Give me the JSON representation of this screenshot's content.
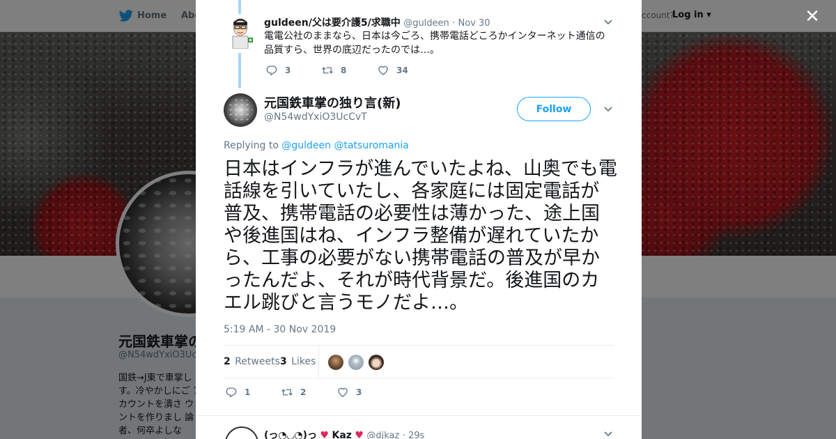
{
  "topnav": {
    "home_label": "Home",
    "about_label": "Abo",
    "account_prompt": "ccount?",
    "login_label": "Log in"
  },
  "profile": {
    "name": "元国鉄車掌の",
    "handle": "@N54wdYxiO3Uc",
    "bio": "国鉄→J東で車掌し す。冷やかしにご アカウントを潰さ ウントを作りまし 論者、何卒よしな"
  },
  "parent_tweet": {
    "name": "guldeen/父は要介護5/求職中",
    "handle": "@guldeen",
    "date": "· Nov 30",
    "text": "電電公社のままなら、日本は今ごろ、携帯電話どころかインターネット通信の品質すら、世界の底辺だったのでは…。",
    "replies": "3",
    "retweets": "8",
    "likes": "34"
  },
  "main_tweet": {
    "name": "元国鉄車掌の独り言(新)",
    "handle": "@N54wdYxiO3UcCvT",
    "follow_label": "Follow",
    "replying_prefix": "Replying to",
    "replying_to_1": "@guldeen",
    "replying_to_2": "@tatsuromania",
    "text": "日本はインフラが進んでいたよね、山奥でも電話線を引いていたし、各家庭には固定電話が普及、携帯電話の必要性は薄かった、途上国や後進国はね、インフラ整備が遅れていたから、工事の必要がない携帯電話の普及が早かったんだよ、それが時代背景だ。後進国のカエル跳びと言うモノだよ…。",
    "timestamp": "5:19 AM - 30 Nov 2019",
    "retweet_count": "2",
    "retweet_label": "Retweets",
    "like_count": "3",
    "like_label": "Likes",
    "replies": "1",
    "retweets": "2",
    "likes": "3"
  },
  "next_tweet": {
    "name_prefix": "(っ◔◡◔)っ",
    "name": "Kaz",
    "handle": "@djkaz",
    "time": "· 29s"
  },
  "colors": {
    "accent": "#1da1f2",
    "thread_line": "#a5d7f5",
    "heart": "#e0245e"
  },
  "icons": [
    "twitter-bird-icon",
    "close-icon",
    "chevron-down-icon",
    "reply-icon",
    "retweet-icon",
    "like-icon"
  ]
}
